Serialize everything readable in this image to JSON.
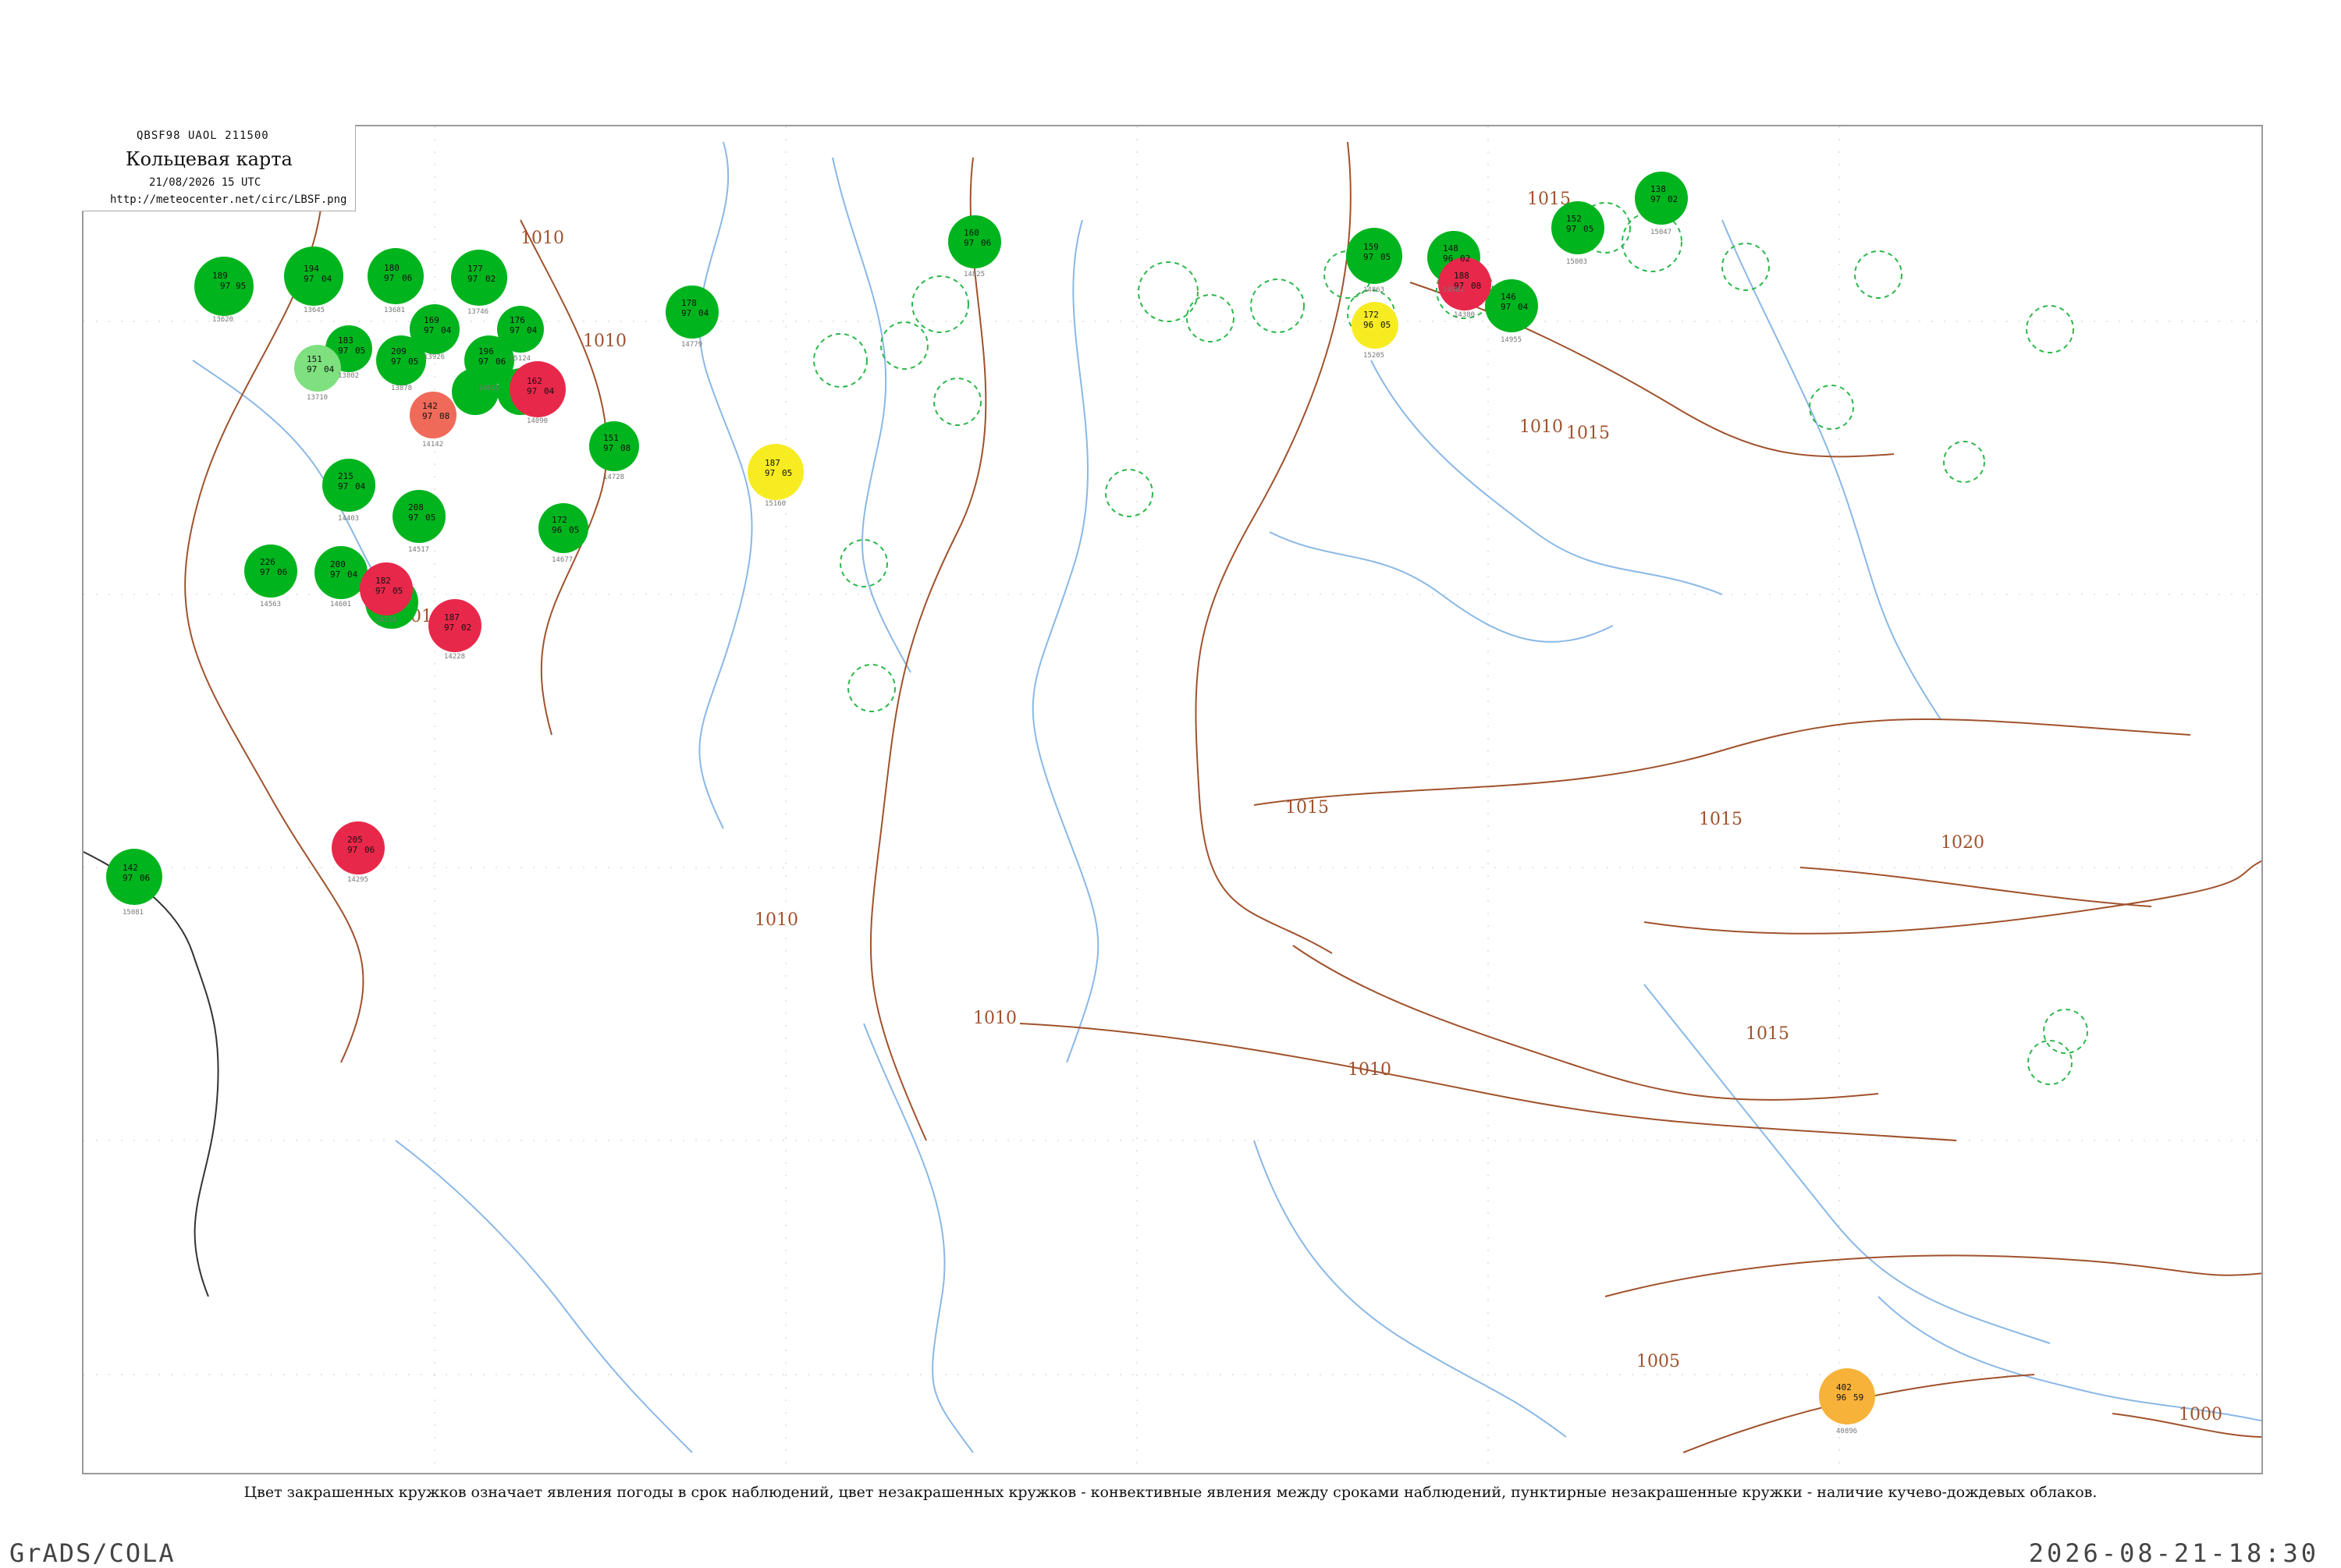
{
  "title": {
    "code": "QBSF98  UAOL  211500",
    "main": "Кольцевая карта",
    "date": "21/08/2026 15 UTC",
    "url": "http://meteocenter.net/circ/LBSF.png"
  },
  "caption": "Цвет закрашенных кружков означает явления погоды в срок наблюдений, цвет незакрашенных кружков - конвективные явления между сроками наблюдений, пунктирные незакрашенные кружки - наличие кучево-дождевых облаков.",
  "footer": {
    "left": "GrADS/COLA",
    "right": "2026-08-21-18:30"
  },
  "colors": {
    "rain": "#00b41e",
    "rain_light": "#7ee07e",
    "thunder": "#e8284a",
    "salmon": "#f06a5a",
    "fog_yellow": "#f7ec22",
    "haze_orange": "#f7b23a",
    "isobar": "#a0522d",
    "river": "#8ab8e6",
    "dashed_cb": "#2cb84a"
  },
  "isobars": [
    {
      "label": "1010"
    },
    {
      "label": "1010"
    },
    {
      "label": "1010"
    },
    {
      "label": "1010"
    },
    {
      "label": "1015"
    },
    {
      "label": "1015"
    },
    {
      "label": "1015"
    },
    {
      "label": "1015"
    },
    {
      "label": "1015"
    },
    {
      "label": "1010"
    },
    {
      "label": "1010"
    },
    {
      "label": "1010"
    },
    {
      "label": "1020"
    },
    {
      "label": "1005"
    },
    {
      "label": "1000"
    }
  ],
  "stations": [
    {
      "id": "st1",
      "t": "189",
      "p": "97",
      "w": "95",
      "name": "13620",
      "kind": "rain"
    },
    {
      "id": "st2",
      "t": "194",
      "p": "97",
      "w": "04",
      "name": "13645",
      "kind": "rain"
    },
    {
      "id": "st3",
      "t": "180",
      "p": "97",
      "w": "06",
      "name": "13681",
      "kind": "rain"
    },
    {
      "id": "st4",
      "t": "177",
      "p": "97",
      "w": "02",
      "name": "13746",
      "kind": "rain"
    },
    {
      "id": "st5",
      "t": "183",
      "p": "97",
      "w": "05",
      "name": "13802",
      "kind": "rain"
    },
    {
      "id": "st6",
      "t": "209",
      "p": "97",
      "w": "05",
      "name": "13878",
      "kind": "rain"
    },
    {
      "id": "st7",
      "t": "169",
      "p": "97",
      "w": "04",
      "name": "13926",
      "kind": "rain"
    },
    {
      "id": "st8",
      "t": "196",
      "p": "97",
      "w": "06",
      "name": "14016",
      "kind": "rain"
    },
    {
      "id": "st9",
      "t": "162",
      "p": "97",
      "w": "04",
      "name": "14090",
      "kind": "thunder"
    },
    {
      "id": "st10",
      "t": "182",
      "p": "97",
      "w": "05",
      "name": "14120",
      "kind": "thunder"
    },
    {
      "id": "st11",
      "t": "187",
      "p": "97",
      "w": "02",
      "name": "14228",
      "kind": "thunder"
    },
    {
      "id": "st12",
      "t": "205",
      "p": "97",
      "w": "06",
      "name": "14295",
      "kind": "thunder"
    },
    {
      "id": "st13",
      "t": "188",
      "p": "97",
      "w": "08",
      "name": "14380",
      "kind": "thunder"
    },
    {
      "id": "st14",
      "t": "215",
      "p": "97",
      "w": "04",
      "name": "14403",
      "kind": "rain"
    },
    {
      "id": "st15",
      "t": "208",
      "p": "97",
      "w": "05",
      "name": "14517",
      "kind": "rain"
    },
    {
      "id": "st16",
      "t": "226",
      "p": "97",
      "w": "06",
      "name": "14563",
      "kind": "rain"
    },
    {
      "id": "st17",
      "t": "200",
      "p": "97",
      "w": "04",
      "name": "14601",
      "kind": "rain"
    },
    {
      "id": "st18",
      "t": "172",
      "p": "96",
      "w": "05",
      "name": "14677",
      "kind": "rain"
    },
    {
      "id": "st19",
      "t": "151",
      "p": "97",
      "w": "08",
      "name": "14728",
      "kind": "rain"
    },
    {
      "id": "st20",
      "t": "178",
      "p": "97",
      "w": "04",
      "name": "14779",
      "kind": "rain"
    },
    {
      "id": "st21",
      "t": "160",
      "p": "97",
      "w": "06",
      "name": "14825",
      "kind": "rain"
    },
    {
      "id": "st22",
      "t": "159",
      "p": "97",
      "w": "05",
      "name": "14863",
      "kind": "rain"
    },
    {
      "id": "st23",
      "t": "148",
      "p": "96",
      "w": "02",
      "name": "14901",
      "kind": "thunder"
    },
    {
      "id": "st24",
      "t": "146",
      "p": "97",
      "w": "04",
      "name": "14955",
      "kind": "rain"
    },
    {
      "id": "st25",
      "t": "152",
      "p": "97",
      "w": "05",
      "name": "15003",
      "kind": "rain"
    },
    {
      "id": "st26",
      "t": "138",
      "p": "97",
      "w": "02",
      "name": "15047",
      "kind": "rain"
    },
    {
      "id": "st27",
      "t": "142",
      "p": "97",
      "w": "06",
      "name": "15081",
      "kind": "rain"
    },
    {
      "id": "st28",
      "t": "176",
      "p": "97",
      "w": "04",
      "name": "15124",
      "kind": "rain"
    },
    {
      "id": "st29",
      "t": "187",
      "p": "97",
      "w": "05",
      "name": "15160",
      "kind": "fog"
    },
    {
      "id": "st30",
      "t": "172",
      "p": "96",
      "w": "05",
      "name": "15205",
      "kind": "fog"
    },
    {
      "id": "st31",
      "t": "402",
      "p": "96",
      "w": "59",
      "name": "40896",
      "kind": "haze"
    },
    {
      "id": "st32",
      "t": "151",
      "p": "97",
      "w": "04",
      "name": "13710",
      "kind": "rain_light"
    },
    {
      "id": "st33",
      "t": "142",
      "p": "97",
      "w": "08",
      "name": "14142",
      "kind": "salmon"
    }
  ]
}
